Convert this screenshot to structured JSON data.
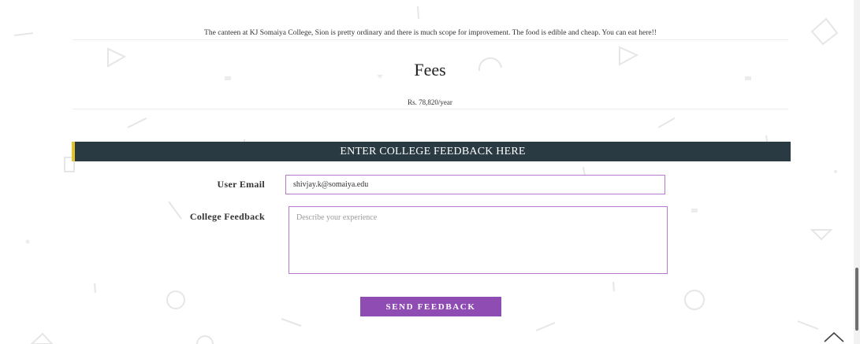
{
  "canteen": {
    "text": "The canteen at KJ Somaiya College, Sion is pretty ordinary and there is much scope for improvement. The food is edible and cheap. You can eat here!!"
  },
  "fees": {
    "title": "Fees",
    "value": "Rs. 78,820/year"
  },
  "feedback_form": {
    "header": "ENTER COLLEGE FEEDBACK HERE",
    "email_label": "User Email",
    "email_value": "shivjay.k@somaiya.edu",
    "feedback_label": "College Feedback",
    "feedback_placeholder": "Describe your experience",
    "submit_label": "SEND FEEDBACK"
  },
  "icons": {
    "scroll_top": "chevron-up-icon"
  },
  "colors": {
    "header_bg": "#2a3a43",
    "header_accent": "#e3c229",
    "button_bg": "#8f4cb3",
    "input_border": "#b57acb"
  }
}
